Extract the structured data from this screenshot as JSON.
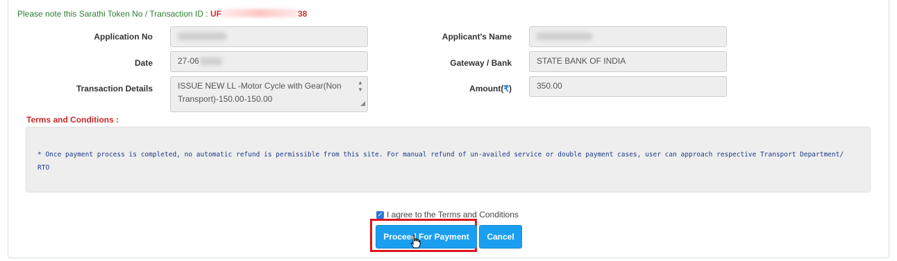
{
  "token": {
    "note_label": "Please note this Sarathi Token No / Transaction ID : ",
    "prefix": "UF",
    "suffix": "38"
  },
  "left_fields": {
    "application_no": {
      "label": "Application No",
      "value": ""
    },
    "date": {
      "label": "Date",
      "value": "27-06"
    },
    "transaction_details": {
      "label": "Transaction Details",
      "value": "ISSUE NEW LL   -Motor Cycle with Gear(Non Transport)-150.00-150.00"
    }
  },
  "right_fields": {
    "applicant_name": {
      "label": "Applicant's Name",
      "value": ""
    },
    "gateway_bank": {
      "label": "Gateway / Bank",
      "value": "STATE BANK OF INDIA"
    },
    "amount": {
      "label": "Amount(",
      "currency": "₹",
      "label_end": ")",
      "value": "350.00"
    }
  },
  "terms": {
    "title": "Terms and Conditions :",
    "text": "* Once payment process is completed, no automatic refund is permissible from this site. For manual refund of un-availed service or double payment cases, user can approach respective Transport Department/ RTO"
  },
  "agree": {
    "label": "I agree to the Terms and Conditions",
    "checked": true
  },
  "buttons": {
    "proceed": "Proceed For Payment",
    "cancel": "Cancel"
  },
  "colors": {
    "primary_button": "#1a9ff0",
    "highlight": "#e0141b",
    "token_green": "#2e7d32",
    "token_red": "#d32f2f",
    "terms_title": "#c62828",
    "terms_text": "#1a3b8a"
  }
}
